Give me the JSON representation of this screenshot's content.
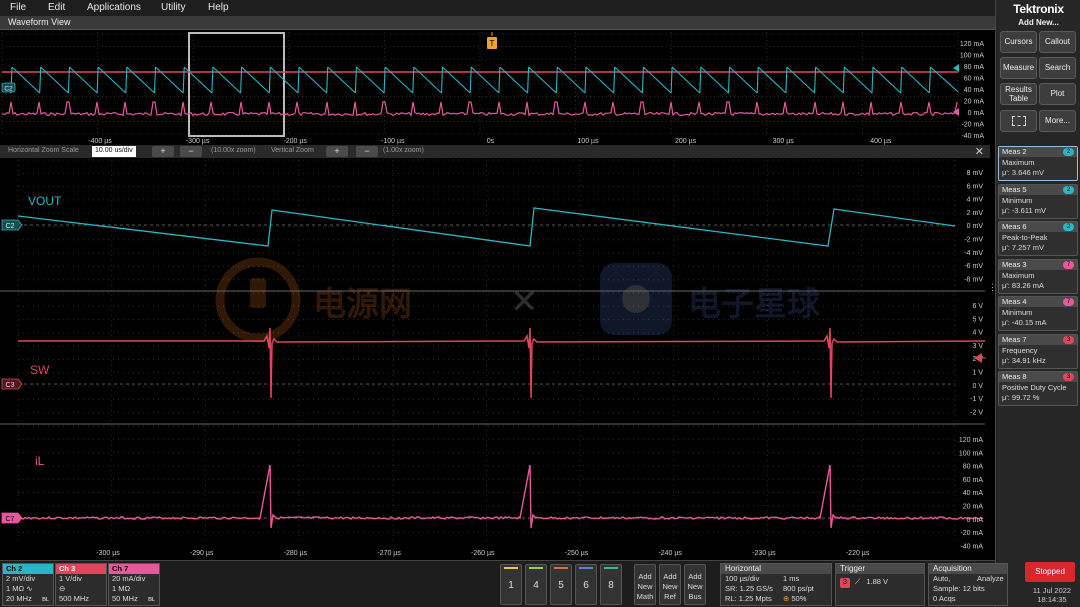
{
  "menu": {
    "file": "File",
    "edit": "Edit",
    "applications": "Applications",
    "utility": "Utility",
    "help": "Help"
  },
  "window_title": "Waveform View",
  "overview": {
    "x_ticks": [
      "-400 µs",
      "-300 µs",
      "-200 µs",
      "-100 µs",
      "0s",
      "100 µs",
      "200 µs",
      "300 µs",
      "400 µs"
    ],
    "right_scale": [
      "120 mA",
      "100 mA",
      "80 mA",
      "60 mA",
      "40 mA",
      "20 mA",
      "0 mA",
      "-20 mA",
      "-40 mA"
    ],
    "ch2_badge": "C2",
    "trigger_marker": "T"
  },
  "zoom_strip": {
    "h_label": "Horizontal Zoom Scale",
    "h_value": "10.00 us/div",
    "h_zoom": "(10.00x zoom)",
    "v_label": "Vertical Zoom",
    "v_zoom": "(1.00x zoom)",
    "plus": "+",
    "minus": "−",
    "close": "✕"
  },
  "waveforms": {
    "vout_label": "VOUT",
    "sw_label": "SW",
    "il_label": "iL",
    "ch2_badge": "C2",
    "ch3_badge": "C3",
    "ch7_badge": "C7",
    "vout_scale": [
      "8 mV",
      "6 mV",
      "4 mV",
      "2 mV",
      "0 mV",
      "-2 mV",
      "-4 mV",
      "-6 mV",
      "-8 mV"
    ],
    "sw_scale": [
      "6 V",
      "5 V",
      "4 V",
      "3 V",
      "2 V",
      "1 V",
      "0 V",
      "-1 V",
      "-2 V"
    ],
    "il_scale": [
      "120 mA",
      "100 mA",
      "80 mA",
      "60 mA",
      "40 mA",
      "20 mA",
      "0 mA",
      "-20 mA",
      "-40 mA"
    ],
    "x_ticks": [
      "-300 µs",
      "-290 µs",
      "-280 µs",
      "-270 µs",
      "-260 µs",
      "-250 µs",
      "-240 µs",
      "-230 µs",
      "-220 µs"
    ],
    "colors": {
      "ch2": "#27b6c4",
      "ch3": "#e0455c",
      "ch7": "#e8579c",
      "grid": "#3a3a3a"
    }
  },
  "watermark": {
    "left": "电源网",
    "x": "✕",
    "right": "电子星球"
  },
  "right_panel": {
    "brand": "Tektronix",
    "add_new": "Add New...",
    "buttons": {
      "cursors": "Cursors",
      "callout": "Callout",
      "measure": "Measure",
      "search": "Search",
      "results1": "Results",
      "results2": "Table",
      "plot": "Plot",
      "more": "More..."
    },
    "measurements": [
      {
        "name": "Meas 2",
        "badge": "2",
        "type": "Maximum",
        "value": "μ': 3.646 mV"
      },
      {
        "name": "Meas 5",
        "badge": "2",
        "type": "Minimum",
        "value": "μ': -3.611 mV"
      },
      {
        "name": "Meas 6",
        "badge": "2",
        "type": "Peak-to-Peak",
        "value": "μ': 7.257 mV"
      },
      {
        "name": "Meas 3",
        "badge": "7",
        "type": "Maximum",
        "value": "μ': 83.26 mA"
      },
      {
        "name": "Meas 4",
        "badge": "7",
        "type": "Minimum",
        "value": "μ': -40.15 mA"
      },
      {
        "name": "Meas 7",
        "badge": "3",
        "type": "Frequency",
        "value": "μ': 34.91 kHz"
      },
      {
        "name": "Meas 8",
        "badge": "3",
        "type": "Positive Duty Cycle",
        "value": "μ': 99.72 %"
      }
    ]
  },
  "bottom": {
    "ch2": {
      "title": "Ch 2",
      "l1": "2 mV/div",
      "l2": "1 MΩ",
      "l3": "20 MHz",
      "sym2": "∿",
      "bw": "ʙʟ"
    },
    "ch3": {
      "title": "Ch 3",
      "l1": "1 V/div",
      "l2": "⊖",
      "l3": "500 MHz"
    },
    "ch7": {
      "title": "Ch 7",
      "l1": "20 mA/div",
      "l2": "1 MΩ",
      "l3": "50 MHz",
      "bw": "ʙʟ"
    },
    "channel_buttons": [
      "1",
      "4",
      "5",
      "6",
      "8"
    ],
    "add_math": [
      "Add",
      "New",
      "Math"
    ],
    "add_ref": [
      "Add",
      "New",
      "Ref"
    ],
    "add_bus": [
      "Add",
      "New",
      "Bus"
    ],
    "horizontal": {
      "title": "Horizontal",
      "a1": "100 µs/div",
      "a2": "1 ms",
      "b1": "SR: 1.25 GS/s",
      "b2": "800 ps/pt",
      "c1": "RL: 1.25 Mpts",
      "c2": "50%"
    },
    "trigger": {
      "title": "Trigger",
      "ch": "3",
      "slope": "⟋",
      "level": "1.88 V"
    },
    "acquisition": {
      "title": "Acquisition",
      "a1": "Auto,",
      "a2": "Analyze",
      "b1": "Sample: 12 bits",
      "c1": "0 Acqs"
    },
    "stopped": "Stopped",
    "date": "11 Jul 2022",
    "time": "18:14:35"
  }
}
